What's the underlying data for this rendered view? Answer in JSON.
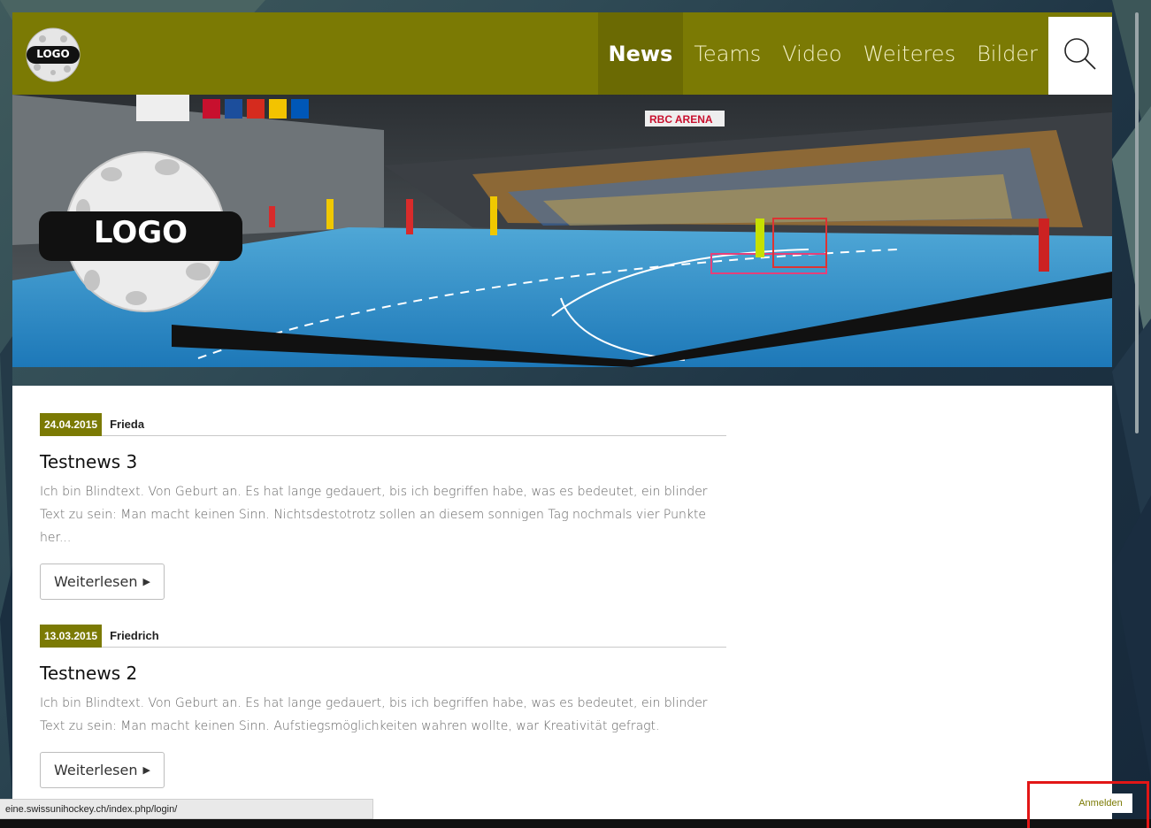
{
  "header": {
    "logo_text": "LOGO",
    "nav": [
      {
        "label": "News",
        "active": true
      },
      {
        "label": "Teams",
        "active": false
      },
      {
        "label": "Video",
        "active": false
      },
      {
        "label": "Weiteres",
        "active": false
      },
      {
        "label": "Bilder",
        "active": false
      }
    ],
    "search_icon": "search-icon"
  },
  "hero": {
    "logo_text": "LOGO",
    "arena_sign": "RBC ARENA"
  },
  "articles": [
    {
      "date": "24.04.2015",
      "author": "Frieda",
      "title": "Testnews 3",
      "excerpt": "Ich bin Blindtext. Von Geburt an. Es hat lange gedauert, bis ich begriffen habe, was es bedeutet, ein blinder Text zu sein: Man macht keinen Sinn. Nichtsdestotrotz sollen an diesem sonnigen Tag nochmals vier Punkte her...",
      "read_more": "Weiterlesen"
    },
    {
      "date": "13.03.2015",
      "author": "Friedrich",
      "title": "Testnews 2",
      "excerpt": "Ich bin Blindtext. Von Geburt an. Es hat lange gedauert, bis ich begriffen habe, was es bedeutet, ein blinder Text zu sein: Man macht keinen Sinn. Aufstiegsmöglichkeiten wahren wollte, war Kreativität gefragt.",
      "read_more": "Weiterlesen"
    }
  ],
  "status_bar": {
    "url": "eine.swissunihockey.ch/index.php/login/"
  },
  "login_link": "Anmelden",
  "colors": {
    "brand": "#7b7a04",
    "highlight": "#e21616"
  }
}
